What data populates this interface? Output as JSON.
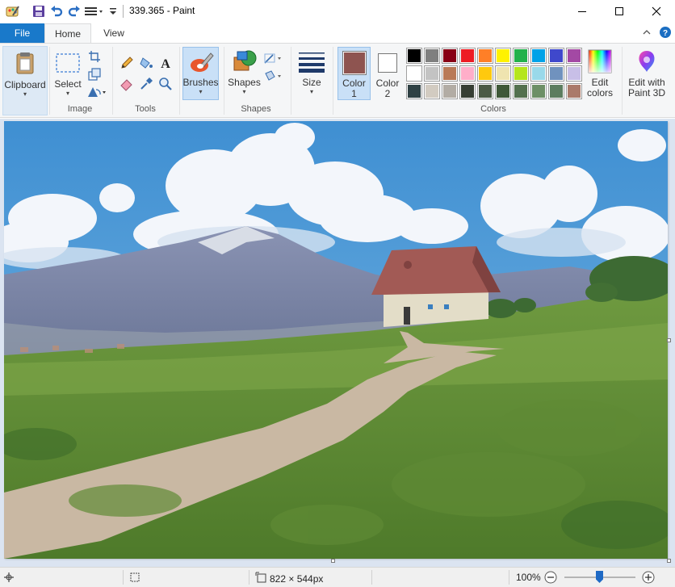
{
  "window": {
    "title": "339.365 - Paint"
  },
  "tabs": {
    "file": "File",
    "home": "Home",
    "view": "View"
  },
  "ribbon": {
    "clipboard": {
      "label": "Clipboard"
    },
    "image": {
      "select_label": "Select",
      "group_label": "Image"
    },
    "tools": {
      "group_label": "Tools"
    },
    "brushes": {
      "label": "Brushes"
    },
    "shapes": {
      "shapes_label": "Shapes",
      "group_label": "Shapes"
    },
    "size": {
      "label": "Size"
    },
    "colors": {
      "color1_label": "Color\n1",
      "color2_label": "Color\n2",
      "color1_line1": "Color",
      "color1_line2": "1",
      "color2_line1": "Color",
      "color2_line2": "2",
      "color1_value": "#8e5450",
      "color2_value": "#ffffff",
      "edit_colors_line1": "Edit",
      "edit_colors_line2": "colors",
      "group_label": "Colors",
      "palette": [
        "#000000",
        "#7f7f7f",
        "#880015",
        "#ed1c24",
        "#ff7f27",
        "#fff200",
        "#22b14c",
        "#00a2e8",
        "#3f48cc",
        "#a349a4",
        "#ffffff",
        "#c3c3c3",
        "#b97a57",
        "#ffaec9",
        "#ffc90e",
        "#efe4b0",
        "#b5e61d",
        "#99d9ea",
        "#7092be",
        "#c8bfe7",
        "#2f4144",
        "#d2cbc1",
        "#b2aca4",
        "#363e33",
        "#4c5a45",
        "#3f5838",
        "#53704e",
        "#6d8f66",
        "#5c7d5f",
        "#aa7a6a"
      ]
    },
    "paint3d": {
      "line1": "Edit with",
      "line2": "Paint 3D"
    }
  },
  "status": {
    "dimensions": "822 × 544px",
    "zoom": "100%"
  }
}
